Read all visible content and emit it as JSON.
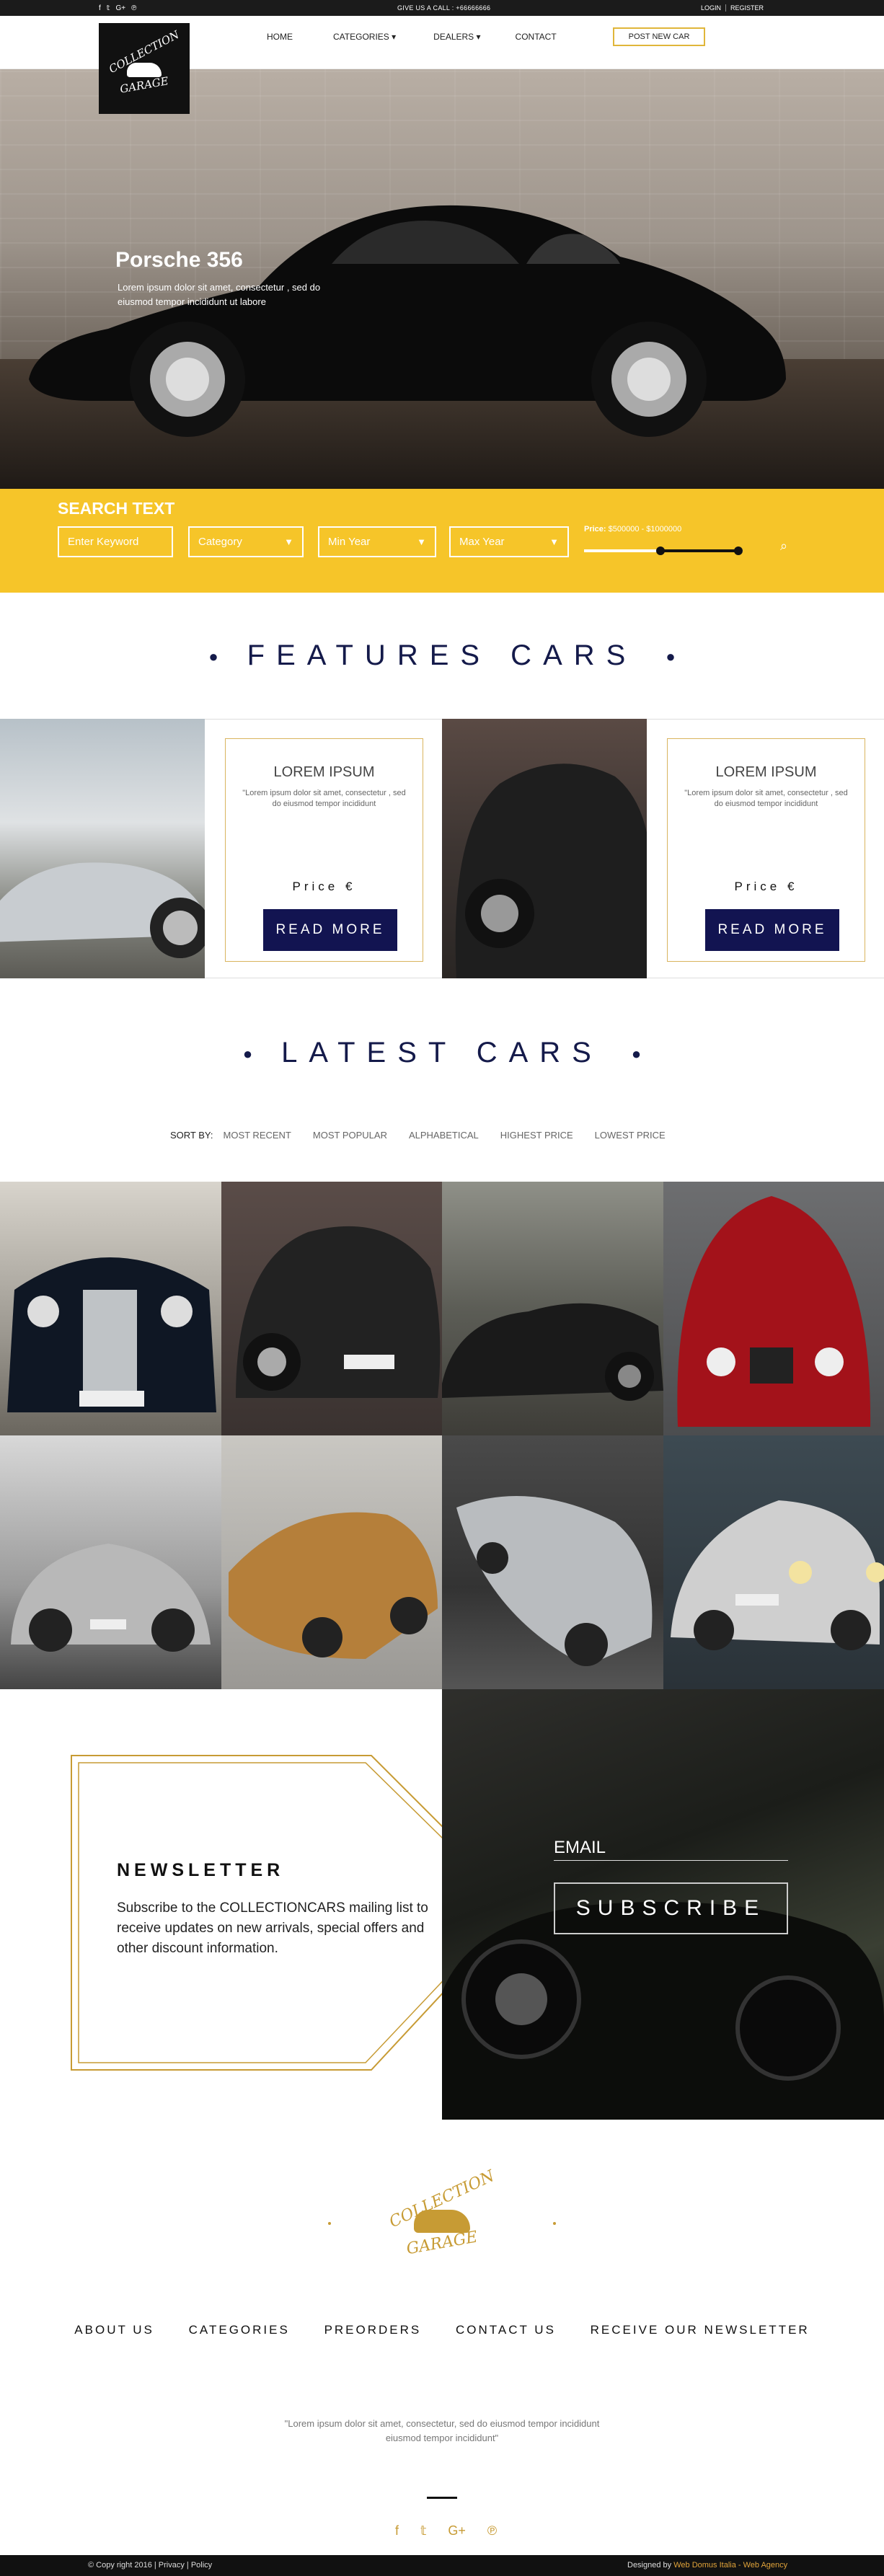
{
  "topbar": {
    "social": [
      "f",
      "𝕥",
      "G+",
      "℗"
    ],
    "call": "GIVE US A CALL : +66666666",
    "login": "LOGIN",
    "register": "REGISTER"
  },
  "logo": {
    "line1": "COLLECTION",
    "line2": "GARAGE"
  },
  "nav": {
    "home": "HOME",
    "categories": "CATEGORIES ▾",
    "dealers": "DEALERS ▾",
    "contact": "CONTACT",
    "post_new_car": "POST NEW CAR"
  },
  "hero": {
    "title": "Porsche 356",
    "text": "Lorem ipsum dolor sit amet, consectetur , sed do eiusmod tempor incididunt ut labore"
  },
  "search": {
    "title": "SEARCH TEXT",
    "keyword_placeholder": "Enter Keyword",
    "category": "Category",
    "min_year": "Min Year",
    "max_year": "Max Year",
    "price_label": "Price:",
    "price_range": "$500000 - $1000000",
    "slider_low": 0.5,
    "slider_high": 1.0
  },
  "features": {
    "title": "FEATURES CARS",
    "cards": [
      {
        "title": "LOREM IPSUM",
        "desc": "\"Lorem ipsum dolor sit amet, consectetur , sed do eiusmod tempor incididunt",
        "price": "Price €",
        "button": "READ MORE"
      },
      {
        "title": "LOREM IPSUM",
        "desc": "\"Lorem ipsum dolor sit amet, consectetur , sed do eiusmod tempor incididunt",
        "price": "Price €",
        "button": "READ MORE"
      }
    ]
  },
  "latest": {
    "title": "LATEST CARS",
    "sort_label": "SORT BY:",
    "sort_options": [
      "MOST RECENT",
      "MOST POPULAR",
      "ALPHABETICAL",
      "HIGHEST PRICE",
      "LOWEST PRICE"
    ]
  },
  "newsletter": {
    "title": "NEWSLETTER",
    "text": "Subscribe to the COLLECTIONCARS mailing list to receive updates on new arrivals, special offers and other discount information.",
    "email_placeholder": "EMAIL",
    "subscribe": "SUBSCRIBE"
  },
  "footer": {
    "logo_line1": "COLLECTION",
    "logo_line2": "GARAGE",
    "nav": [
      "ABOUT US",
      "CATEGORIES",
      "PREORDERS",
      "CONTACT US",
      "RECEIVE OUR NEWSLETTER"
    ],
    "quote": "\"Lorem ipsum dolor sit amet, consectetur, sed do eiusmod tempor incididunt eiusmod tempor incididunt\"",
    "social": [
      "f",
      "𝕥",
      "G+",
      "℗"
    ],
    "copyright": "© Copy right 2016 | Privacy | Policy",
    "designed_by": "Designed by",
    "designer": "Web Domus Italia - Web Agency"
  },
  "colors": {
    "accent_yellow": "#f6c529",
    "navy": "#121451",
    "gold": "#c79b34"
  }
}
